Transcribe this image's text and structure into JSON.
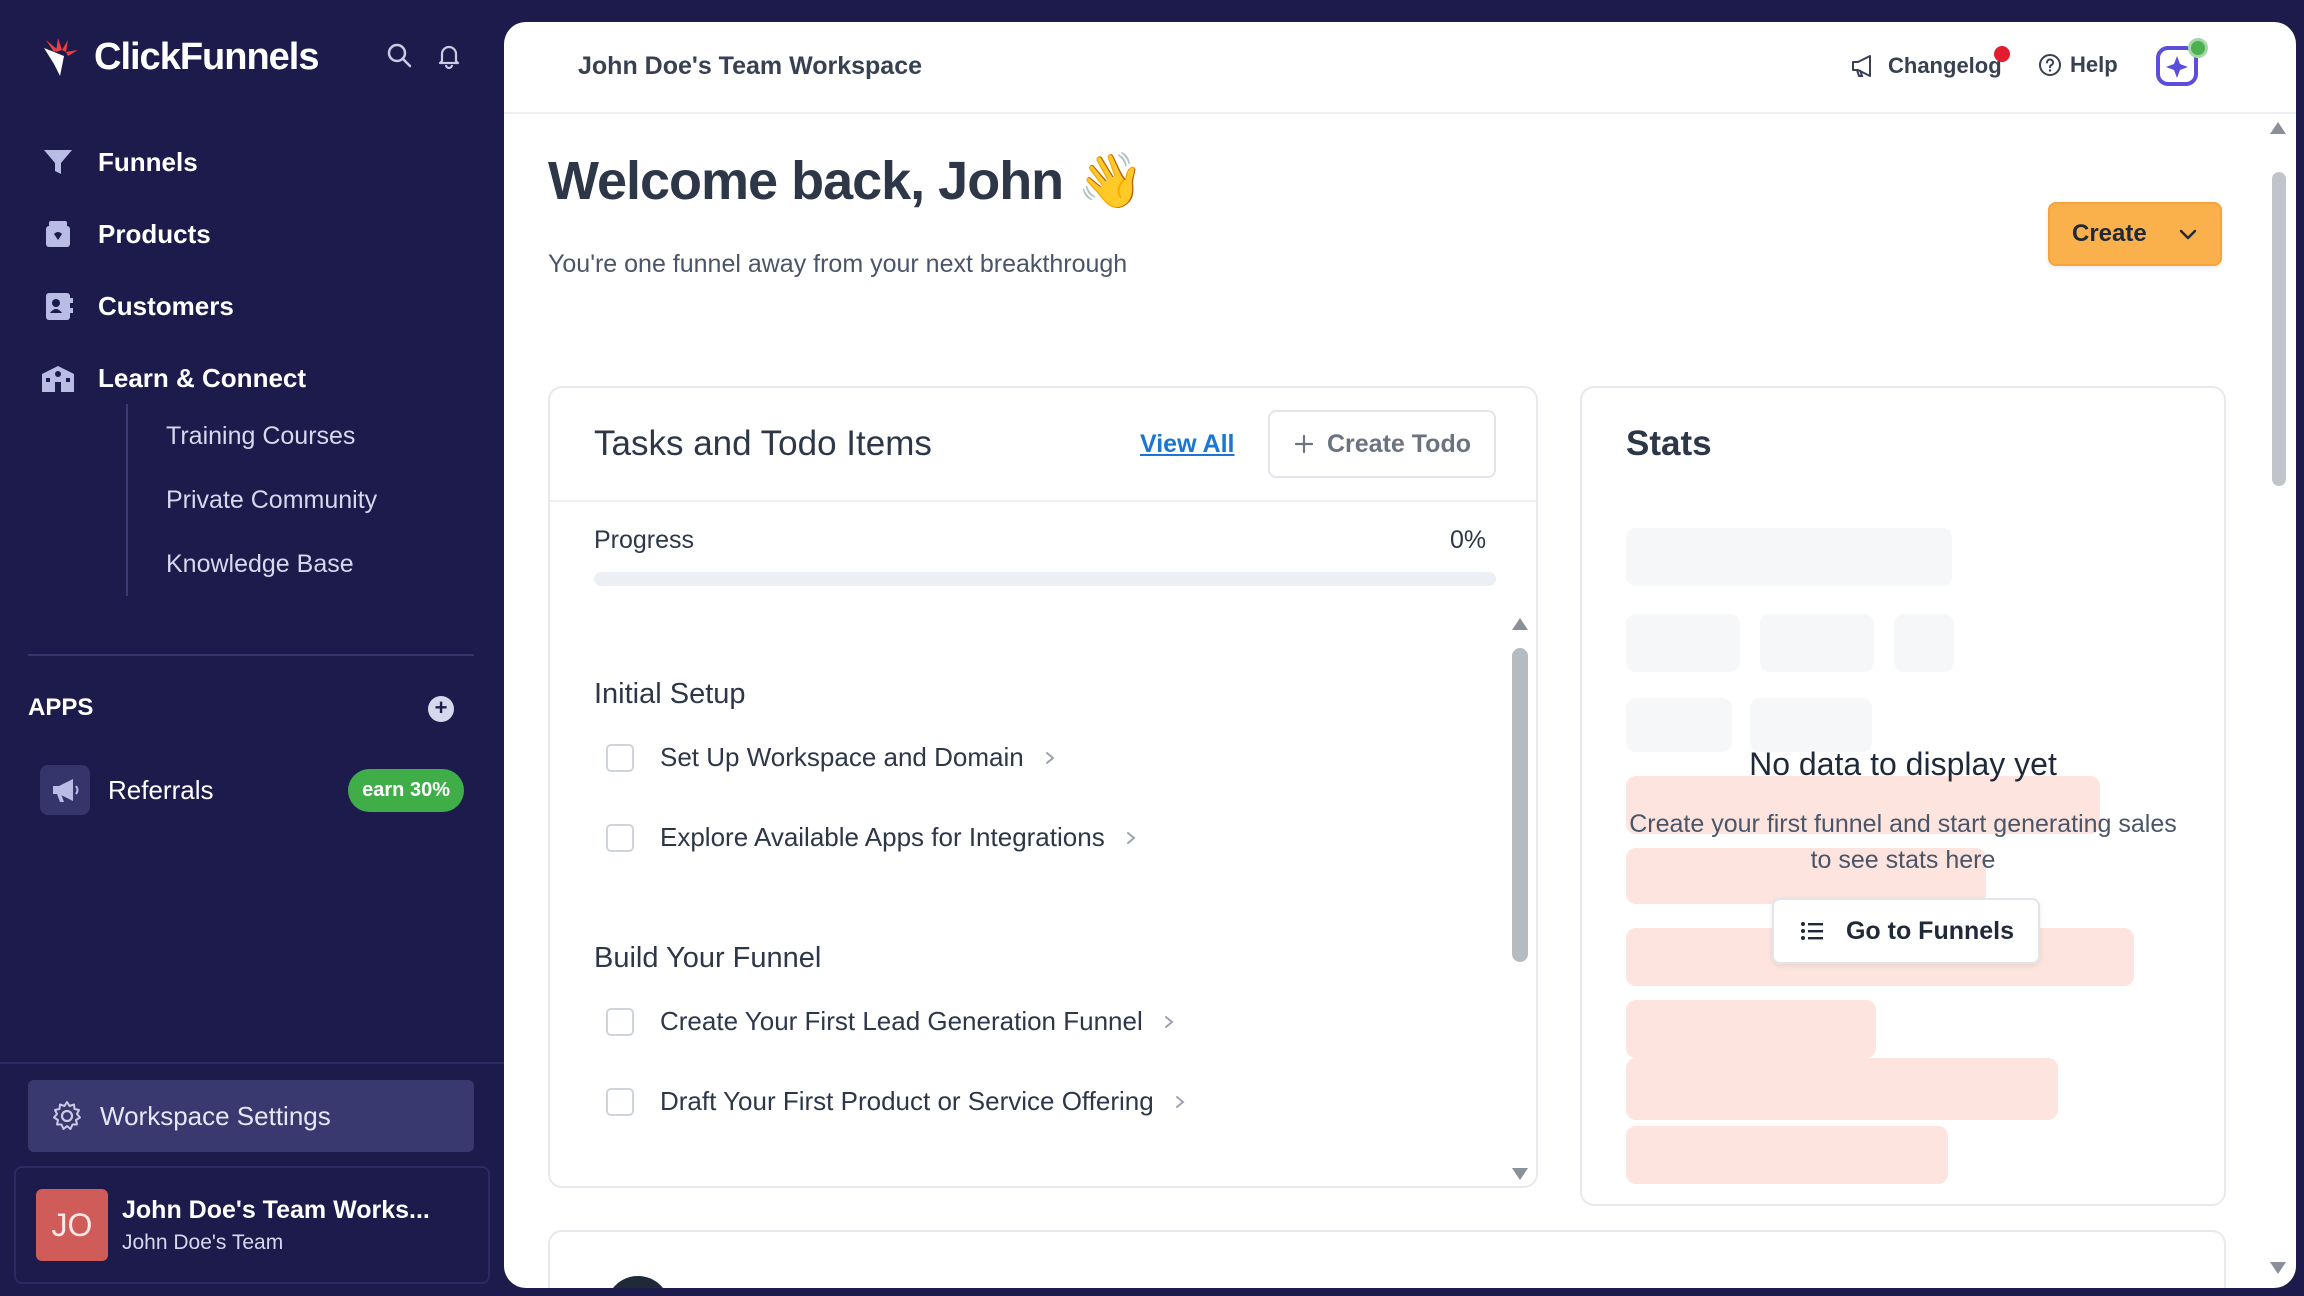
{
  "sidebar": {
    "brand": "ClickFunnels",
    "nav": [
      {
        "label": "Funnels"
      },
      {
        "label": "Products"
      },
      {
        "label": "Customers"
      },
      {
        "label": "Learn & Connect"
      }
    ],
    "subnav": [
      {
        "label": "Training Courses"
      },
      {
        "label": "Private Community"
      },
      {
        "label": "Knowledge Base"
      }
    ],
    "apps_label": "APPS",
    "apps_add": "+",
    "referral": {
      "label": "Referrals",
      "badge": "earn 30%"
    },
    "workspace_settings": "Workspace Settings",
    "account": {
      "initials": "JO",
      "name": "John Doe's Team Works...",
      "team": "John Doe's Team"
    }
  },
  "topbar": {
    "workspace_title": "John Doe's Team Workspace",
    "changelog": "Changelog",
    "help": "Help"
  },
  "hero": {
    "title": "Welcome back, John 👋",
    "subtitle": "You're one funnel away from your next breakthrough",
    "create_label": "Create"
  },
  "tasks": {
    "title": "Tasks and Todo Items",
    "view_all": "View All",
    "create_todo": "Create Todo",
    "progress_label": "Progress",
    "progress_value": "0%",
    "progress_fraction": 0,
    "groups": [
      {
        "title": "Initial Setup",
        "items": [
          {
            "label": "Set Up Workspace and Domain"
          },
          {
            "label": "Explore Available Apps for Integrations"
          }
        ]
      },
      {
        "title": "Build Your Funnel",
        "items": [
          {
            "label": "Create Your First Lead Generation Funnel"
          },
          {
            "label": "Draft Your First Product or Service Offering"
          }
        ]
      }
    ]
  },
  "stats": {
    "title": "Stats",
    "empty_title": "No data to display yet",
    "empty_subtitle": "Create your first funnel and start generating sales to see stats here",
    "goto_label": "Go to Funnels"
  },
  "colors": {
    "sidebar_bg": "#1c1b4b",
    "accent": "#fbb14b",
    "link": "#1976d2",
    "badge_green": "#3fae49",
    "notification_red": "#e11d2e"
  }
}
